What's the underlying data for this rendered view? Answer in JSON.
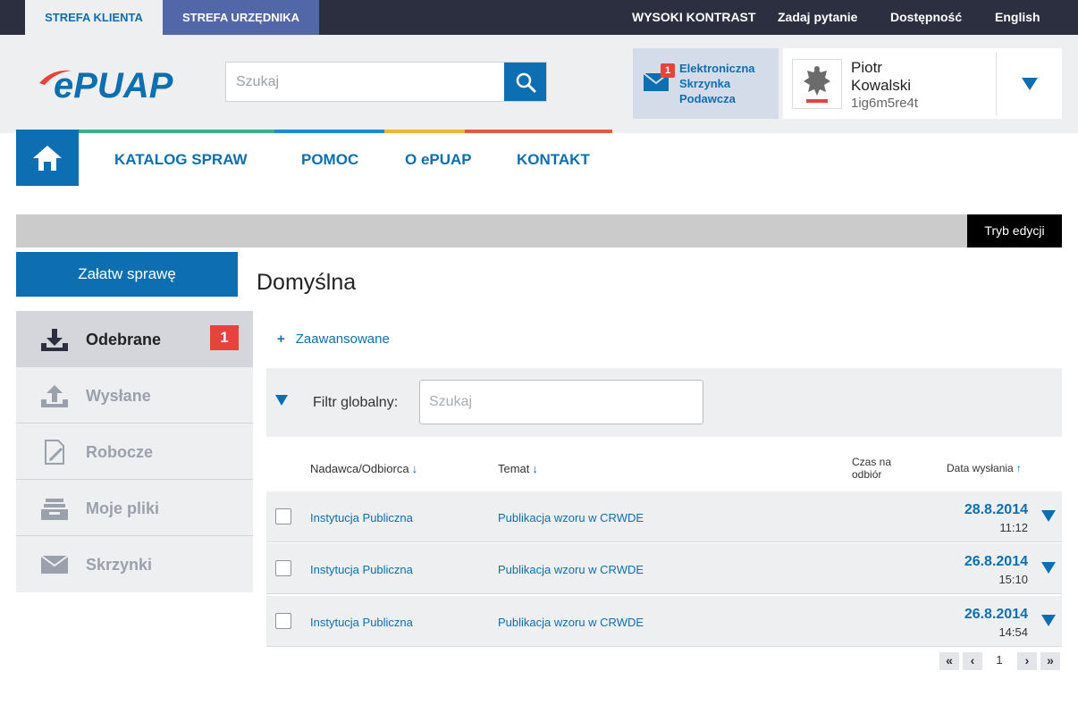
{
  "topbar": {
    "zone_client": "STREFA KLIENTA",
    "zone_official": "STREFA URZĘDNIKA",
    "links": [
      "WYSOKI KONTRAST",
      "Zadaj pytanie",
      "Dostępność",
      "English"
    ]
  },
  "header": {
    "logo_text": "ePUAP",
    "search_placeholder": "Szukaj",
    "esp": {
      "badge": "1",
      "line1": "Elektroniczna",
      "line2": "Skrzynka",
      "line3": "Podawcza"
    },
    "user": {
      "first_name": "Piotr",
      "last_name": "Kowalski",
      "login": "1ig6m5re4t"
    }
  },
  "nav": {
    "items": [
      "KATALOG SPRAW",
      "POMOC",
      "O ePUAP",
      "KONTAKT"
    ]
  },
  "edit_mode_label": "Tryb edycji",
  "sidebar": {
    "case_button": "Załatw sprawę",
    "items": [
      {
        "label": "Odebrane",
        "badge": "1",
        "icon": "inbox-download-icon"
      },
      {
        "label": "Wysłane",
        "icon": "outbox-upload-icon"
      },
      {
        "label": "Robocze",
        "icon": "draft-edit-icon"
      },
      {
        "label": "Moje pliki",
        "icon": "file-tray-icon"
      },
      {
        "label": "Skrzynki",
        "icon": "envelope-icon"
      }
    ]
  },
  "main": {
    "title": "Domyślna",
    "advanced_label": "Zaawansowane",
    "filter_label": "Filtr globalny:",
    "filter_placeholder": "Szukaj",
    "columns": {
      "sender": "Nadawca/Odbiorca",
      "subject": "Temat",
      "receipt_time_line1": "Czas na",
      "receipt_time_line2": "odbiór",
      "sent_date": "Data wysłania"
    },
    "rows": [
      {
        "sender": "Instytucja Publiczna",
        "subject": "Publikacja wzoru w  CRWDE",
        "date": "28.8.2014",
        "time": "11:12"
      },
      {
        "sender": "Instytucja Publiczna",
        "subject": "Publikacja wzoru w  CRWDE",
        "date": "26.8.2014",
        "time": "15:10"
      },
      {
        "sender": "Instytucja Publiczna",
        "subject": "Publikacja wzoru w  CRWDE",
        "date": "26.8.2014",
        "time": "14:54"
      }
    ],
    "pagination": {
      "first": "«",
      "prev": "‹",
      "current": "1",
      "next": "›",
      "last": "»"
    }
  },
  "colors": {
    "brand_blue": "#0d6fb1",
    "topbar_dark": "#2b2f3f",
    "official_zone": "#5167a8",
    "badge_red": "#e5433b",
    "nav_line_green": "#3dae8f",
    "nav_line_blue": "#1e88d3",
    "nav_line_yellow": "#f2b632",
    "nav_line_red": "#e05b46"
  }
}
